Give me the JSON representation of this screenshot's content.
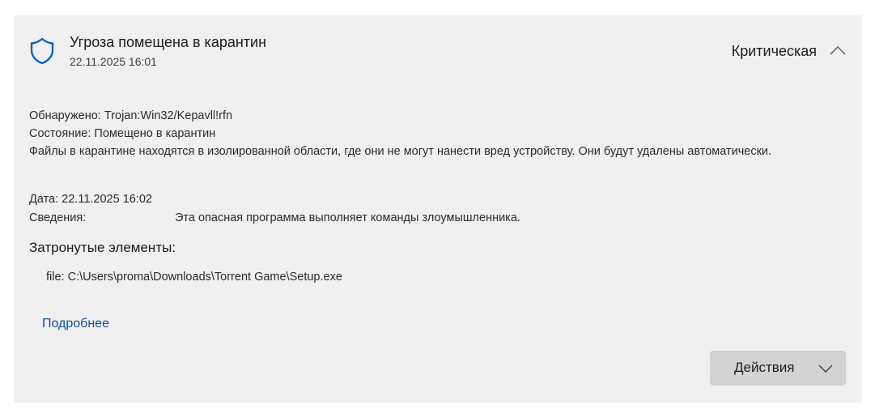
{
  "threat": {
    "title": "Угроза помещена в карантин",
    "timestamp": "22.11.2025 16:01",
    "severity": "Критическая",
    "expanded": true
  },
  "details": {
    "detected_label": "Обнаружено:",
    "detected_value": "Trojan:Win32/Kepavll!rfn",
    "status_label": "Состояние:",
    "status_value": "Помещено в карантин",
    "description": "Файлы в карантине находятся в изолированной области, где они не могут нанести вред устройству. Они будут удалены автоматически.",
    "date_label": "Дата:",
    "date_value": "22.11.2025 16:02",
    "info_label": "Сведения:",
    "info_value": "Эта опасная программа выполняет команды злоумышленника."
  },
  "affected": {
    "title": "Затронутые элементы:",
    "items": [
      "file: C:\\Users\\proma\\Downloads\\Torrent Game\\Setup.exe"
    ]
  },
  "links": {
    "more": "Подробнее"
  },
  "actions": {
    "label": "Действия"
  },
  "icons": {
    "shield": "shield-icon",
    "collapse": "chevron-up-icon",
    "dropdown": "chevron-down-icon"
  },
  "colors": {
    "accent": "#0067c0",
    "link": "#0b4f9c",
    "card_bg": "#f0f0f0",
    "button_bg": "#d3d3d3"
  }
}
